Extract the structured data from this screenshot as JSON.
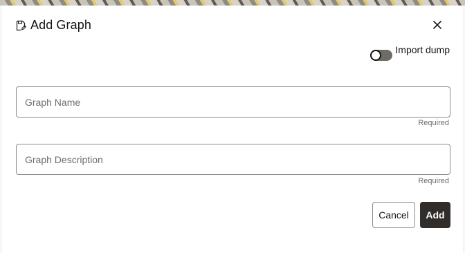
{
  "dialog": {
    "title": "Add Graph",
    "title_icon": "save-file-icon",
    "close_icon": "close-icon"
  },
  "import_dump": {
    "label": "Import dump",
    "enabled": false
  },
  "fields": {
    "graph_name": {
      "placeholder": "Graph Name",
      "value": "",
      "hint": "Required"
    },
    "graph_description": {
      "placeholder": "Graph Description",
      "value": "",
      "hint": "Required"
    }
  },
  "actions": {
    "cancel_label": "Cancel",
    "add_label": "Add"
  }
}
